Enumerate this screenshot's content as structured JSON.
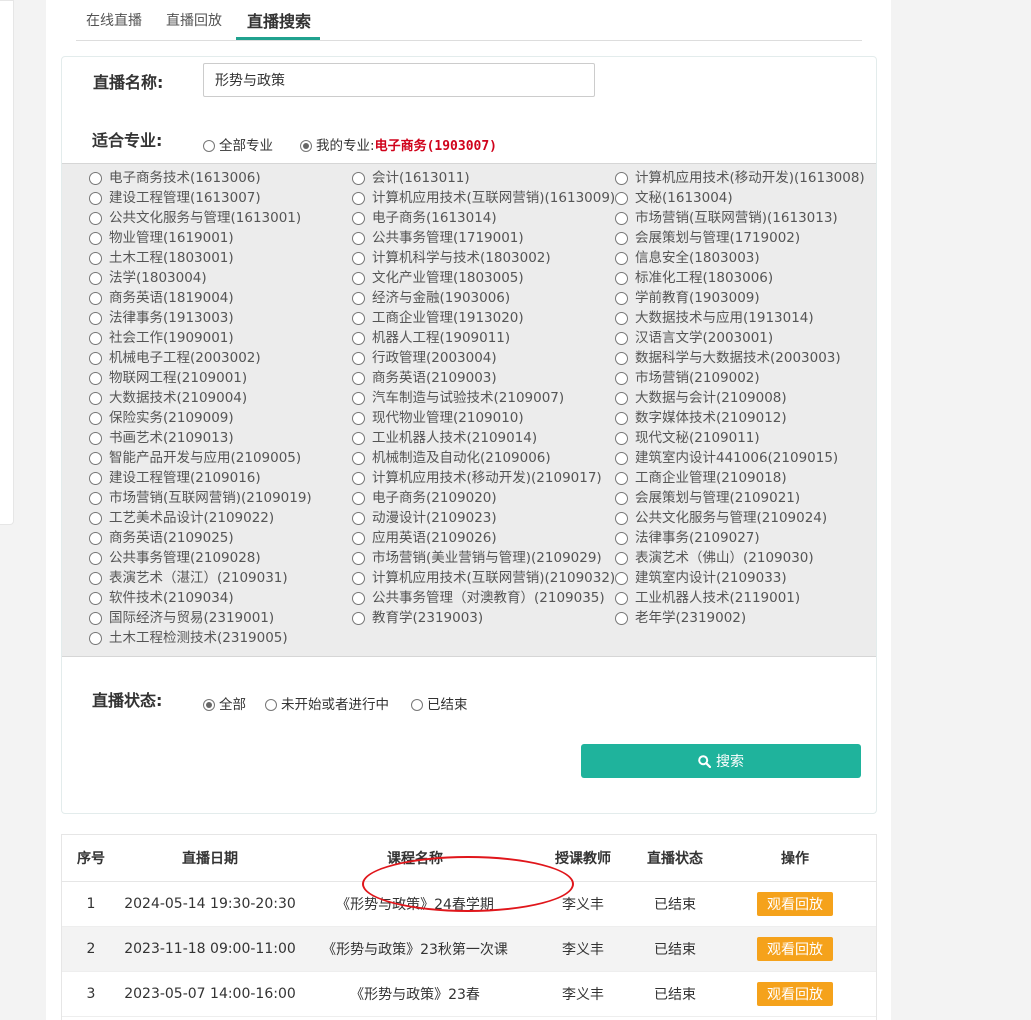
{
  "tabs": [
    {
      "label": "在线直播"
    },
    {
      "label": "直播回放"
    },
    {
      "label": "直播搜索"
    }
  ],
  "search": {
    "name_label": "直播名称:",
    "name_value": "形势与政策",
    "major_label": "适合专业:",
    "all_majors": "全部专业",
    "my_major_prefix": "我的专业:",
    "my_major": "电子商务(1903007)",
    "status_label": "直播状态:",
    "status_options": [
      "全部",
      "未开始或者进行中",
      "已结束"
    ],
    "button_label": "搜索"
  },
  "majors": {
    "col1": [
      "电子商务技术(1613006)",
      "建设工程管理(1613007)",
      "公共文化服务与管理(1613001)",
      "物业管理(1619001)",
      "土木工程(1803001)",
      "法学(1803004)",
      "商务英语(1819004)",
      "法律事务(1913003)",
      "社会工作(1909001)",
      "机械电子工程(2003002)",
      "物联网工程(2109001)",
      "大数据技术(2109004)",
      "保险实务(2109009)",
      "书画艺术(2109013)",
      "智能产品开发与应用(2109005)",
      "建设工程管理(2109016)",
      "市场营销(互联网营销)(2109019)",
      "工艺美术品设计(2109022)",
      "商务英语(2109025)",
      "公共事务管理(2109028)",
      "表演艺术（湛江）(2109031)",
      "软件技术(2109034)",
      "国际经济与贸易(2319001)",
      "土木工程检测技术(2319005)"
    ],
    "col2": [
      "会计(1613011)",
      "计算机应用技术(互联网营销)(1613009)",
      "电子商务(1613014)",
      "公共事务管理(1719001)",
      "计算机科学与技术(1803002)",
      "文化产业管理(1803005)",
      "经济与金融(1903006)",
      "工商企业管理(1913020)",
      "机器人工程(1909011)",
      "行政管理(2003004)",
      "商务英语(2109003)",
      "汽车制造与试验技术(2109007)",
      "现代物业管理(2109010)",
      "工业机器人技术(2109014)",
      "机械制造及自动化(2109006)",
      "计算机应用技术(移动开发)(2109017)",
      "电子商务(2109020)",
      "动漫设计(2109023)",
      "应用英语(2109026)",
      "市场营销(美业营销与管理)(2109029)",
      "计算机应用技术(互联网营销)(2109032)",
      "公共事务管理（对澳教育）(2109035)",
      "教育学(2319003)"
    ],
    "col3": [
      "计算机应用技术(移动开发)(1613008)",
      "文秘(1613004)",
      "市场营销(互联网营销)(1613013)",
      "会展策划与管理(1719002)",
      "信息安全(1803003)",
      "标准化工程(1803006)",
      "学前教育(1903009)",
      "大数据技术与应用(1913014)",
      "汉语言文学(2003001)",
      "数据科学与大数据技术(2003003)",
      "市场营销(2109002)",
      "大数据与会计(2109008)",
      "数字媒体技术(2109012)",
      "现代文秘(2109011)",
      "建筑室内设计441006(2109015)",
      "工商企业管理(2109018)",
      "会展策划与管理(2109021)",
      "公共文化服务与管理(2109024)",
      "法律事务(2109027)",
      "表演艺术（佛山）(2109030)",
      "建筑室内设计(2109033)",
      "工业机器人技术(2119001)",
      "老年学(2319002)"
    ]
  },
  "results": {
    "headers": [
      "序号",
      "直播日期",
      "课程名称",
      "授课教师",
      "直播状态",
      "操作"
    ],
    "rows": [
      {
        "no": "1",
        "date": "2024-05-14 19:30-20:30",
        "course": "《形势与政策》24春学期",
        "teacher": "李义丰",
        "status": "已结束",
        "action": "观看回放"
      },
      {
        "no": "2",
        "date": "2023-11-18 09:00-11:00",
        "course": "《形势与政策》23秋第一次课",
        "teacher": "李义丰",
        "status": "已结束",
        "action": "观看回放"
      },
      {
        "no": "3",
        "date": "2023-05-07 14:00-16:00",
        "course": "《形势与政策》23春",
        "teacher": "李义丰",
        "status": "已结束",
        "action": "观看回放"
      }
    ]
  },
  "colors": {
    "accent": "#1fb39c",
    "replay": "#f5a21b",
    "highlight": "#e0161b",
    "my_major": "#d0021b"
  }
}
